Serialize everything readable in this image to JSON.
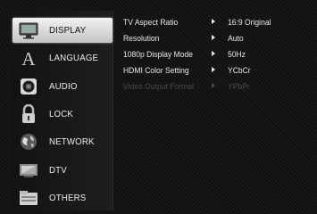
{
  "sidebar": {
    "items": [
      {
        "label": "DISPLAY",
        "icon": "monitor-icon",
        "selected": true
      },
      {
        "label": "LANGUAGE",
        "icon": "letter-a-icon",
        "selected": false
      },
      {
        "label": "AUDIO",
        "icon": "speaker-icon",
        "selected": false
      },
      {
        "label": "LOCK",
        "icon": "padlock-icon",
        "selected": false
      },
      {
        "label": "NETWORK",
        "icon": "globe-icon",
        "selected": false
      },
      {
        "label": "DTV",
        "icon": "tv-icon",
        "selected": false
      },
      {
        "label": "OTHERS",
        "icon": "folder-icon",
        "selected": false
      }
    ]
  },
  "options": [
    {
      "name": "TV Aspect Ratio",
      "value": "16:9 Original",
      "enabled": true
    },
    {
      "name": "Resolution",
      "value": "Auto",
      "enabled": true
    },
    {
      "name": "1080p Display Mode",
      "value": "50Hz",
      "enabled": true
    },
    {
      "name": "HDMI Color Setting",
      "value": "YCbCr",
      "enabled": true
    },
    {
      "name": "Video Output Format",
      "value": "YPbPr",
      "enabled": false
    }
  ],
  "colors": {
    "highlight": "#e6e6e6",
    "text": "#ececec",
    "disabled_text": "#4a4a4a"
  }
}
